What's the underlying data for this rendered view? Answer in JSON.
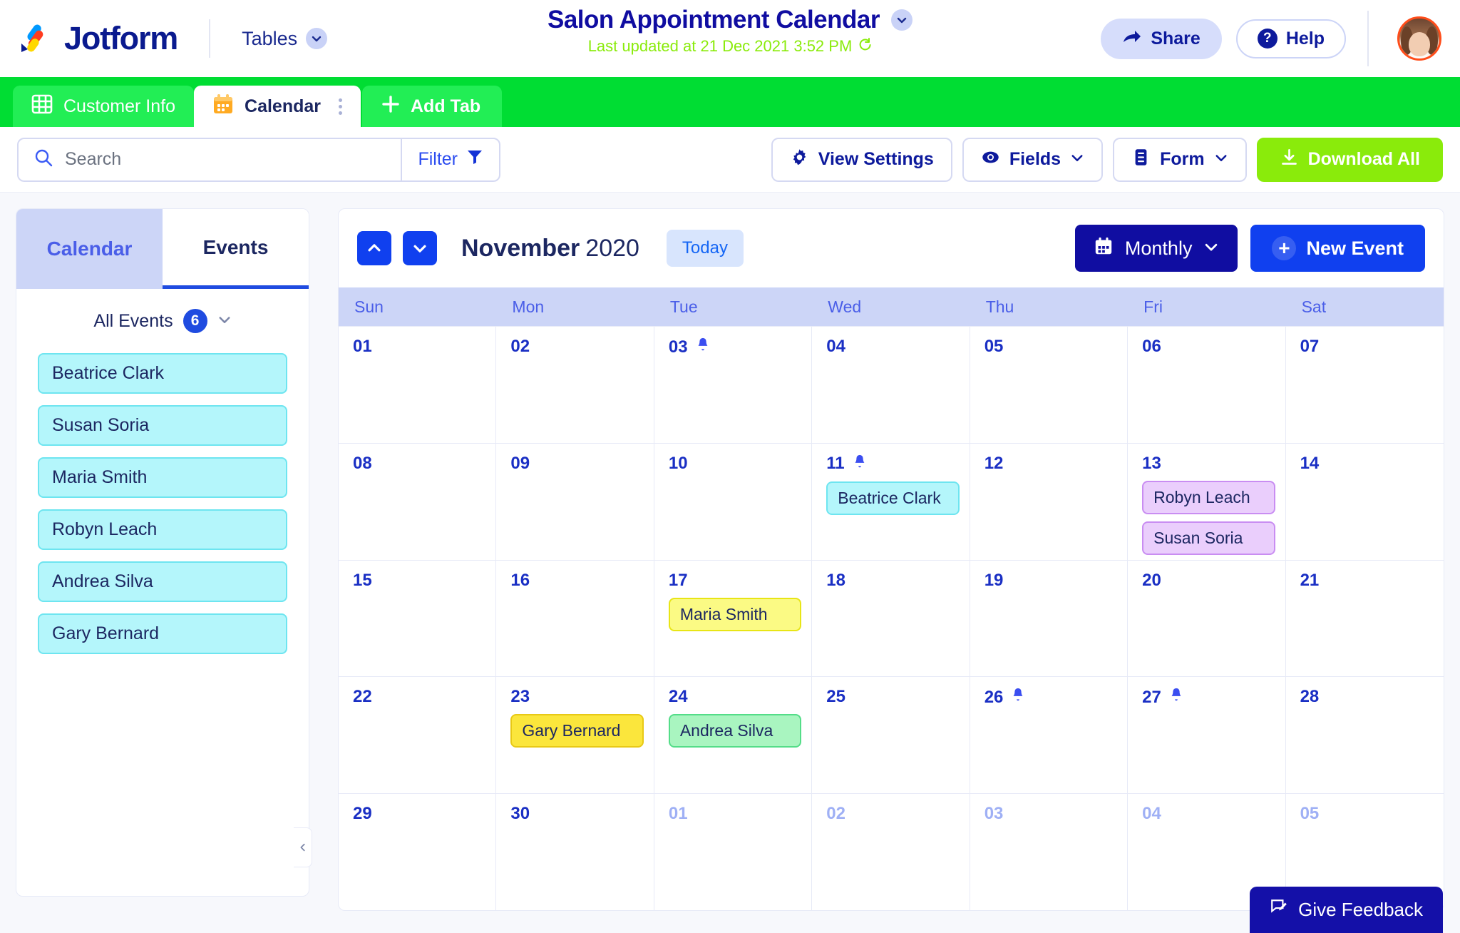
{
  "header": {
    "brand_name": "Jotform",
    "tables_menu": "Tables",
    "doc_title": "Salon Appointment Calendar",
    "last_updated": "Last updated at 21 Dec 2021 3:52 PM",
    "share_label": "Share",
    "help_label": "Help",
    "help_badge": "?"
  },
  "tabs": {
    "items": [
      {
        "label": "Customer Info",
        "icon": "grid-icon",
        "active": false
      },
      {
        "label": "Calendar",
        "icon": "calendar-icon",
        "active": true
      }
    ],
    "add_tab_label": "Add Tab",
    "add_tab_icon": "plus-icon"
  },
  "toolbar": {
    "search_placeholder": "Search",
    "search_value": "",
    "search_icon": "search-icon",
    "filter_label": "Filter",
    "filter_icon": "funnel-icon",
    "view_settings_label": "View Settings",
    "view_settings_icon": "gear-icon",
    "fields_label": "Fields",
    "fields_icon": "eye-icon",
    "form_label": "Form",
    "form_icon": "form-list-icon",
    "download_label": "Download All",
    "download_icon": "download-icon"
  },
  "sidebar": {
    "tab_calendar": "Calendar",
    "tab_events": "Events",
    "all_events_label": "All Events",
    "all_events_count": "6",
    "events": [
      {
        "name": "Beatrice Clark"
      },
      {
        "name": "Susan Soria"
      },
      {
        "name": "Maria Smith"
      },
      {
        "name": "Robyn Leach"
      },
      {
        "name": "Andrea Silva"
      },
      {
        "name": "Gary Bernard"
      }
    ]
  },
  "calendar": {
    "prev_icon": "chevron-up-icon",
    "next_icon": "chevron-down-icon",
    "month": "November",
    "year": "2020",
    "today_label": "Today",
    "view_mode": "Monthly",
    "view_mode_icon": "calendar-icon",
    "new_event_label": "New Event",
    "weekdays": [
      "Sun",
      "Mon",
      "Tue",
      "Wed",
      "Thu",
      "Fri",
      "Sat"
    ],
    "weeks": [
      [
        {
          "day": "01",
          "muted": false,
          "bell": false,
          "events": []
        },
        {
          "day": "02",
          "muted": false,
          "bell": false,
          "events": []
        },
        {
          "day": "03",
          "muted": false,
          "bell": true,
          "events": []
        },
        {
          "day": "04",
          "muted": false,
          "bell": false,
          "events": []
        },
        {
          "day": "05",
          "muted": false,
          "bell": false,
          "events": []
        },
        {
          "day": "06",
          "muted": false,
          "bell": false,
          "events": []
        },
        {
          "day": "07",
          "muted": false,
          "bell": false,
          "events": []
        }
      ],
      [
        {
          "day": "08",
          "muted": false,
          "bell": false,
          "events": []
        },
        {
          "day": "09",
          "muted": false,
          "bell": false,
          "events": []
        },
        {
          "day": "10",
          "muted": false,
          "bell": false,
          "events": []
        },
        {
          "day": "11",
          "muted": false,
          "bell": true,
          "events": [
            {
              "title": "Beatrice Clark",
              "color": "cyan"
            }
          ]
        },
        {
          "day": "12",
          "muted": false,
          "bell": false,
          "events": []
        },
        {
          "day": "13",
          "muted": false,
          "bell": false,
          "events": [
            {
              "title": "Robyn Leach",
              "color": "purple"
            },
            {
              "title": "Susan Soria",
              "color": "purple"
            }
          ]
        },
        {
          "day": "14",
          "muted": false,
          "bell": false,
          "events": []
        }
      ],
      [
        {
          "day": "15",
          "muted": false,
          "bell": false,
          "events": []
        },
        {
          "day": "16",
          "muted": false,
          "bell": false,
          "events": []
        },
        {
          "day": "17",
          "muted": false,
          "bell": false,
          "events": [
            {
              "title": "Maria Smith",
              "color": "yellow"
            }
          ]
        },
        {
          "day": "18",
          "muted": false,
          "bell": false,
          "events": []
        },
        {
          "day": "19",
          "muted": false,
          "bell": false,
          "events": []
        },
        {
          "day": "20",
          "muted": false,
          "bell": false,
          "events": []
        },
        {
          "day": "21",
          "muted": false,
          "bell": false,
          "events": []
        }
      ],
      [
        {
          "day": "22",
          "muted": false,
          "bell": false,
          "events": []
        },
        {
          "day": "23",
          "muted": false,
          "bell": false,
          "events": [
            {
              "title": "Gary Bernard",
              "color": "gold"
            }
          ]
        },
        {
          "day": "24",
          "muted": false,
          "bell": false,
          "events": [
            {
              "title": "Andrea Silva",
              "color": "green"
            }
          ]
        },
        {
          "day": "25",
          "muted": false,
          "bell": false,
          "events": []
        },
        {
          "day": "26",
          "muted": false,
          "bell": true,
          "events": []
        },
        {
          "day": "27",
          "muted": false,
          "bell": true,
          "events": []
        },
        {
          "day": "28",
          "muted": false,
          "bell": false,
          "events": []
        }
      ],
      [
        {
          "day": "29",
          "muted": false,
          "bell": false,
          "events": []
        },
        {
          "day": "30",
          "muted": false,
          "bell": false,
          "events": []
        },
        {
          "day": "01",
          "muted": true,
          "bell": false,
          "events": []
        },
        {
          "day": "02",
          "muted": true,
          "bell": false,
          "events": []
        },
        {
          "day": "03",
          "muted": true,
          "bell": false,
          "events": []
        },
        {
          "day": "04",
          "muted": true,
          "bell": false,
          "events": []
        },
        {
          "day": "05",
          "muted": true,
          "bell": false,
          "events": []
        }
      ]
    ]
  },
  "feedback": {
    "label": "Give Feedback",
    "icon": "feedback-icon"
  },
  "colors": {
    "brand_navy": "#100da1",
    "tab_green": "#00dd33",
    "accent_blue": "#1040ef",
    "lime": "#8aeb0b",
    "lavender": "#ccd5f7"
  }
}
